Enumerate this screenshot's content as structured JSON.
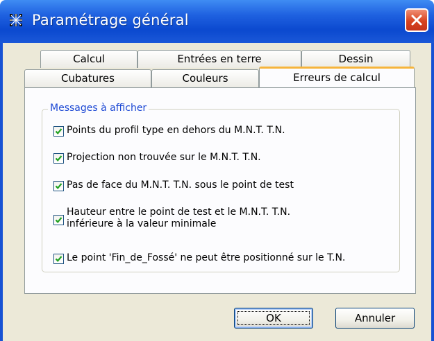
{
  "window": {
    "title": "Paramétrage général",
    "icons": {
      "app": "grid-app-icon",
      "close": "close-icon"
    },
    "colors": {
      "titlebar": "#0b49cf",
      "close": "#d8431f",
      "accent_tab": "#f6b43b",
      "group_title": "#1c48d4"
    }
  },
  "tabs": {
    "back_row": [
      {
        "label": "Calcul"
      },
      {
        "label": "Entrées en terre"
      },
      {
        "label": "Dessin"
      }
    ],
    "front_row": [
      {
        "label": "Cubatures"
      },
      {
        "label": "Couleurs"
      },
      {
        "label": "Erreurs de calcul",
        "selected": true
      }
    ]
  },
  "group": {
    "title": "Messages à afficher",
    "options": [
      {
        "label": "Points du profil type en dehors du M.N.T. T.N.",
        "checked": true
      },
      {
        "label": "Projection non trouvée sur le M.N.T. T.N.",
        "checked": true
      },
      {
        "label": "Pas de face du M.N.T. T.N. sous le point de test",
        "checked": true
      },
      {
        "label_line1": "Hauteur entre le point de test et le M.N.T. T.N.",
        "label_line2": "inférieure à la valeur minimale",
        "checked": true
      },
      {
        "label": "Le point 'Fin_de_Fossé' ne peut être positionné sur le T.N.",
        "checked": true
      }
    ]
  },
  "buttons": {
    "ok": "OK",
    "cancel": "Annuler"
  }
}
